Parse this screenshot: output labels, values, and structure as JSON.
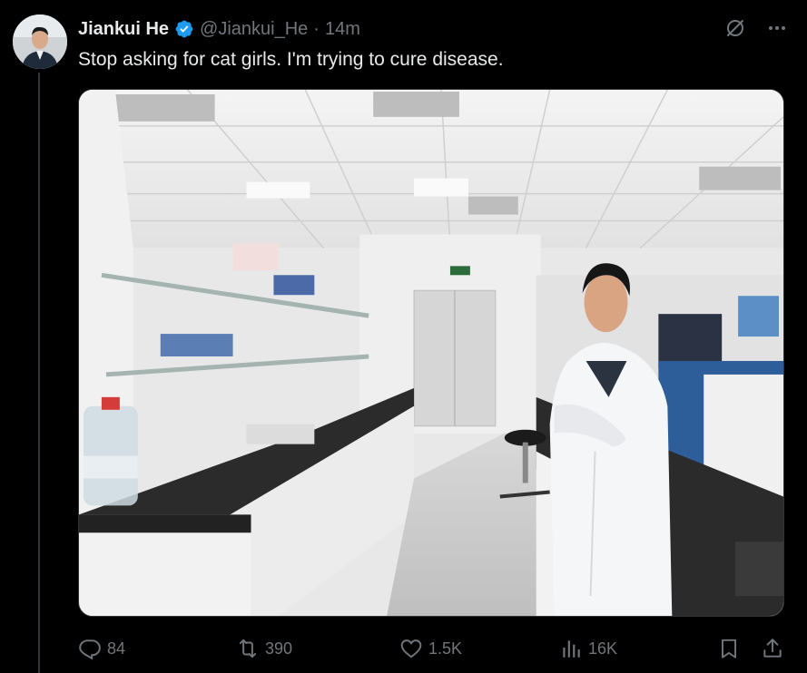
{
  "tweet": {
    "display_name": "Jiankui He",
    "handle": "@Jiankui_He",
    "separator": "·",
    "time": "14m",
    "text": "Stop asking for cat girls. I'm trying to cure disease.",
    "verified": true
  },
  "icons": {
    "verified": "verified-badge-icon",
    "grok": "grok-icon",
    "more": "more-icon",
    "reply": "reply-icon",
    "retweet": "retweet-icon",
    "like": "like-icon",
    "views": "views-icon",
    "bookmark": "bookmark-icon",
    "share": "share-icon"
  },
  "actions": {
    "replies": "84",
    "retweets": "390",
    "likes": "1.5K",
    "views": "16K"
  },
  "colors": {
    "background": "#000000",
    "text_primary": "#e7e9ea",
    "text_secondary": "#71767b",
    "verified": "#1d9bf0"
  }
}
